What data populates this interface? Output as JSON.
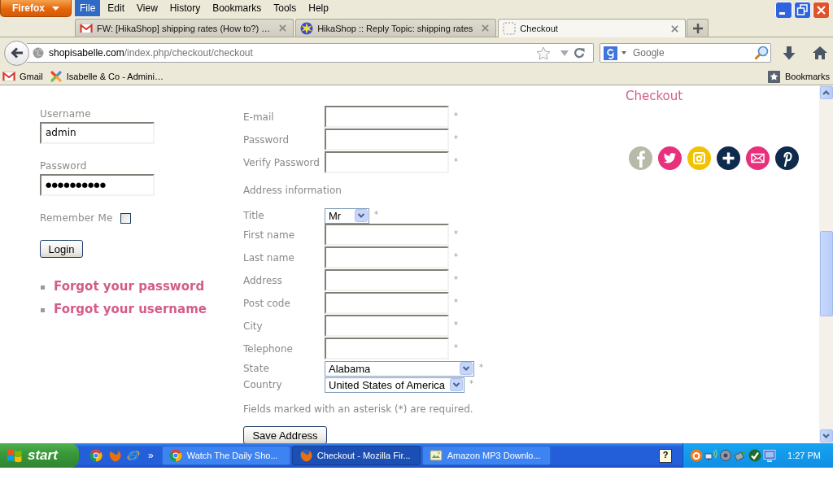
{
  "window": {
    "app_button": "Firefox",
    "menu": [
      {
        "label": "File",
        "selected": true
      },
      {
        "label": "Edit",
        "selected": false
      },
      {
        "label": "View",
        "selected": false
      },
      {
        "label": "History",
        "selected": false
      },
      {
        "label": "Bookmarks",
        "selected": false
      },
      {
        "label": "Tools",
        "selected": false
      },
      {
        "label": "Help",
        "selected": false
      }
    ]
  },
  "tabs": [
    {
      "title": "FW: [HikaShop] shipping rates (How to?) …",
      "selected": false
    },
    {
      "title": "HikaShop :: Reply Topic: shipping rates",
      "selected": false
    },
    {
      "title": "Checkout",
      "selected": true
    }
  ],
  "navigation": {
    "url_host": "shopisabelle.com",
    "url_path": "/index.php/checkout/checkout",
    "search": {
      "placeholder": "Google"
    }
  },
  "bookmarks_bar": {
    "items": [
      "Gmail",
      "Isabelle & Co - Admini…"
    ],
    "menu_label": "Bookmarks"
  },
  "login": {
    "fields": [
      {
        "label": "Username",
        "kind": "text",
        "value": "admin"
      },
      {
        "label": "Password",
        "kind": "password",
        "value": "●●●●●●●●●●"
      }
    ],
    "remember": {
      "label": "Remember Me",
      "checked": false
    },
    "button": "Login",
    "links": [
      "Forgot your password",
      "Forgot your username"
    ]
  },
  "address": {
    "account_fields": [
      {
        "label": "E-mail",
        "mark": "*"
      },
      {
        "label": "Password",
        "mark": "*"
      },
      {
        "label": "Verify Password",
        "mark": "*"
      }
    ],
    "section_title": "Address information",
    "fields": [
      {
        "label": "Title",
        "kind": "select",
        "value": "Mr",
        "mark": "*"
      },
      {
        "label": "First name",
        "kind": "text",
        "mark": "*"
      },
      {
        "label": "Last name",
        "kind": "text",
        "mark": "*"
      },
      {
        "label": "Address",
        "kind": "text",
        "mark": "*"
      },
      {
        "label": "Post code",
        "kind": "text",
        "mark": "*"
      },
      {
        "label": "City",
        "kind": "text",
        "mark": "*"
      },
      {
        "label": "Telephone",
        "kind": "text",
        "mark": "*"
      },
      {
        "label": "State",
        "kind": "select",
        "value": "Alabama",
        "mark": "*"
      },
      {
        "label": "Country",
        "kind": "select",
        "value": "United States of America",
        "mark": "*"
      }
    ],
    "note": "Fields marked with an asterisk (*) are required.",
    "button": "Save Address"
  },
  "sidebar": {
    "title": "Checkout"
  },
  "taskbar": {
    "start": "start",
    "more": "»",
    "windows": [
      {
        "label": "Watch The Daily Sho...",
        "selected": false
      },
      {
        "label": "Checkout - Mozilla Fir...",
        "selected": true
      },
      {
        "label": "Amazon MP3 Downlo...",
        "selected": false
      }
    ],
    "help_mark": "?",
    "clock": "1:27 PM"
  }
}
